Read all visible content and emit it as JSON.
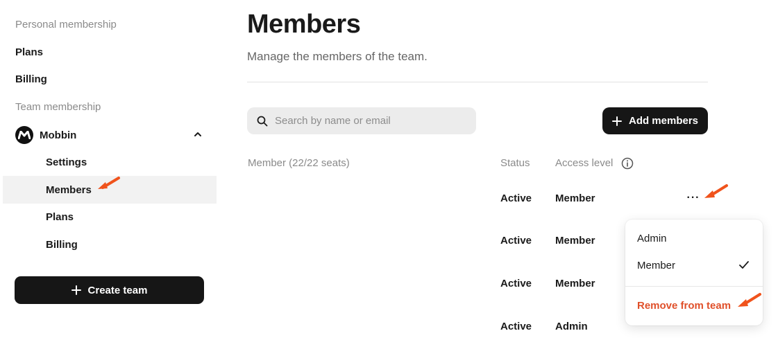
{
  "sidebar": {
    "personal_label": "Personal membership",
    "plans": "Plans",
    "billing": "Billing",
    "team_label": "Team membership",
    "team_name": "Mobbin",
    "team_sub": [
      "Settings",
      "Members",
      "Plans",
      "Billing"
    ],
    "create_team": "Create team"
  },
  "main": {
    "title": "Members",
    "subtitle": "Manage the members of the team.",
    "search_placeholder": "Search by name or email",
    "add_members": "Add members",
    "columns": {
      "member": "Member (22/22 seats)",
      "status": "Status",
      "access": "Access level"
    },
    "rows": [
      {
        "status": "Active",
        "access": "Member"
      },
      {
        "status": "Active",
        "access": "Member"
      },
      {
        "status": "Active",
        "access": "Member"
      },
      {
        "status": "Active",
        "access": "Admin"
      }
    ],
    "more_label": "···"
  },
  "menu": {
    "admin": "Admin",
    "member": "Member",
    "remove": "Remove from team"
  },
  "colors": {
    "accent_orange": "#f0531c",
    "remove_text": "#e0502a",
    "button_dark": "#161616",
    "active_bg": "#f2f2f2"
  }
}
